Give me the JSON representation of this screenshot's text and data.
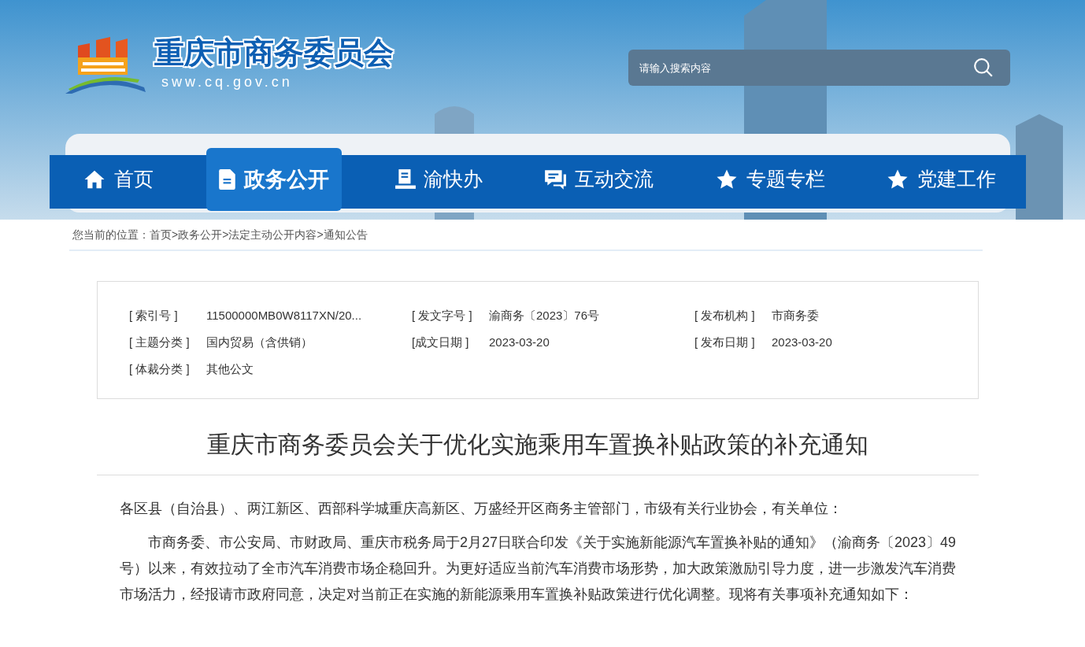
{
  "header": {
    "site_name": "重庆市商务委员会",
    "domain": "sww.cq.gov.cn",
    "search": {
      "placeholder": "请输入搜索内容"
    }
  },
  "nav": [
    {
      "label": "首页",
      "selected": false
    },
    {
      "label": "政务公开",
      "selected": true
    },
    {
      "label": "渝快办",
      "selected": false
    },
    {
      "label": "互动交流",
      "selected": false
    },
    {
      "label": "专题专栏",
      "selected": false
    },
    {
      "label": "党建工作",
      "selected": false
    }
  ],
  "breadcrumb": {
    "label": "您当前的位置：",
    "separator": ">",
    "items": [
      "首页",
      "政务公开",
      "法定主动公开内容",
      "通知公告"
    ]
  },
  "metadata": [
    {
      "label": "[ 索引号 ]",
      "value": "11500000MB0W8117XN/20..."
    },
    {
      "label": "[ 发文字号 ]",
      "value": "渝商务〔2023〕76号"
    },
    {
      "label": "[ 发布机构 ]",
      "value": "市商务委"
    },
    {
      "label": "[ 主题分类 ]",
      "value": "国内贸易（含供销）"
    },
    {
      "label": "[成文日期 ]",
      "value": "2023-03-20"
    },
    {
      "label": "[ 发布日期 ]",
      "value": "2023-03-20"
    },
    {
      "label": "[ 体裁分类 ]",
      "value": "其他公文"
    }
  ],
  "article": {
    "title": "重庆市商务委员会关于优化实施乘用车置换补贴政策的补充通知",
    "paragraphs": [
      {
        "kind": "salutation",
        "text": "各区县（自治县）、两江新区、西部科学城重庆高新区、万盛经开区商务主管部门，市级有关行业协会，有关单位："
      },
      {
        "kind": "body",
        "text": "市商务委、市公安局、市财政局、重庆市税务局于2月27日联合印发《关于实施新能源汽车置换补贴的通知》（渝商务〔2023〕49号）以来，有效拉动了全市汽车消费市场企稳回升。为更好适应当前汽车消费市场形势，加大政策激励引导力度，进一步激发汽车消费市场活力，经报请市政府同意，决定对当前正在实施的新能源乘用车置换补贴政策进行优化调整。现将有关事项补充通知如下："
      }
    ]
  }
}
